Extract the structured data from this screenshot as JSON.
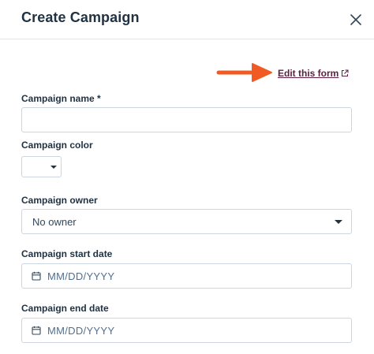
{
  "dialog": {
    "title": "Create Campaign",
    "close_icon": "close-icon"
  },
  "edit_form": {
    "label": "Edit this form",
    "icon": "external-link-icon",
    "arrow_color": "#f15a22"
  },
  "fields": {
    "campaign_name": {
      "label": "Campaign name *",
      "value": ""
    },
    "campaign_color": {
      "label": "Campaign color",
      "value": ""
    },
    "campaign_owner": {
      "label": "Campaign owner",
      "value": "No owner"
    },
    "start_date": {
      "label": "Campaign start date",
      "placeholder": "MM/DD/YYYY",
      "icon": "calendar-icon"
    },
    "end_date": {
      "label": "Campaign end date",
      "placeholder": "MM/DD/YYYY",
      "icon": "calendar-icon"
    }
  },
  "colors": {
    "link": "#5e2042",
    "border": "#cbd6e2",
    "text": "#213343",
    "arrow": "#f15a22"
  }
}
